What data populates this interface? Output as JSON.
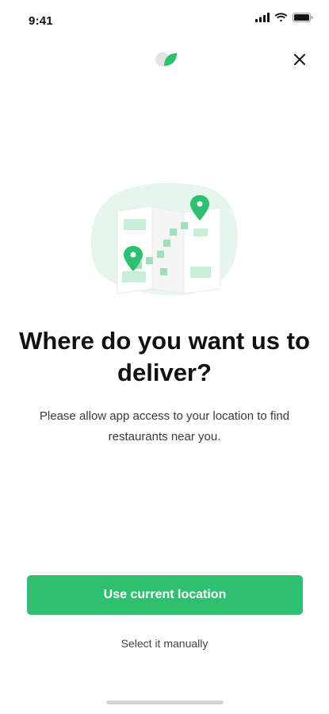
{
  "status_bar": {
    "time": "9:41",
    "icons": [
      "cellular-signal-icon",
      "wifi-icon",
      "battery-icon"
    ]
  },
  "header": {
    "logo_icon": "brand-logo-icon",
    "close_icon": "close-icon"
  },
  "illustration": {
    "icon": "map-location-pins-icon"
  },
  "content": {
    "title": "Where do you want us to deliver?",
    "description": "Please allow app access to your location to find restaurants near you."
  },
  "actions": {
    "primary_label": "Use current location",
    "secondary_label": "Select it manually"
  },
  "colors": {
    "accent": "#2fbf71",
    "accent_light": "#e6f6ec",
    "text_primary": "#111111",
    "text_secondary": "#3a3a3a",
    "background": "#ffffff"
  }
}
